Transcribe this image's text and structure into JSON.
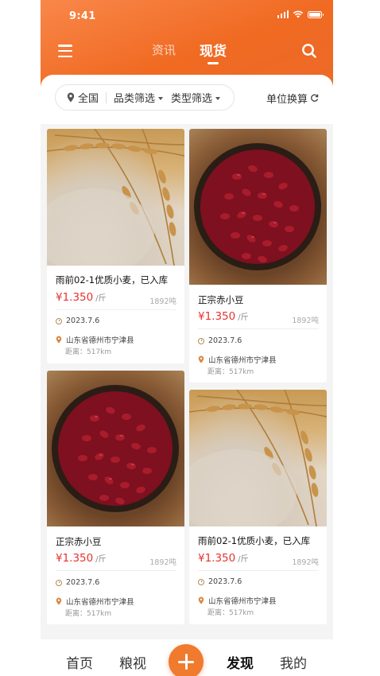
{
  "status_bar": {
    "time": "9:41"
  },
  "nav": {
    "tabs": [
      {
        "label": "资讯"
      },
      {
        "label": "现货"
      }
    ]
  },
  "filters": {
    "region": "全国",
    "category": "品类筛选",
    "type": "类型筛选",
    "unit_convert": "单位换算"
  },
  "products": [
    {
      "title": "雨前02-1优质小麦，已入库",
      "price": "¥1.350",
      "unit": "/斤",
      "stock": "1892吨",
      "date": "2023.7.6",
      "address": "山东省德州市宁津县",
      "distance": "距离：517km",
      "image": "wheat"
    },
    {
      "title": "正宗赤小豆",
      "price": "¥1.350",
      "unit": "/斤",
      "stock": "1892吨",
      "date": "2023.7.6",
      "address": "山东省德州市宁津县",
      "distance": "距离：517km",
      "image": "red-beans"
    },
    {
      "title": "正宗赤小豆",
      "price": "¥1.350",
      "unit": "/斤",
      "stock": "1892吨",
      "date": "2023.7.6",
      "address": "山东省德州市宁津县",
      "distance": "距离：517km",
      "image": "red-beans"
    },
    {
      "title": "雨前02-1优质小麦，已入库",
      "price": "¥1.350",
      "unit": "/斤",
      "stock": "1892吨",
      "date": "2023.7.6",
      "address": "山东省德州市宁津县",
      "distance": "距离：517km",
      "image": "wheat"
    }
  ],
  "bottom_nav": {
    "items": [
      {
        "label": "首页"
      },
      {
        "label": "粮视"
      },
      {
        "label": "发现"
      },
      {
        "label": "我的"
      }
    ]
  },
  "colors": {
    "accent": "#f06a22",
    "price": "#e53330"
  }
}
